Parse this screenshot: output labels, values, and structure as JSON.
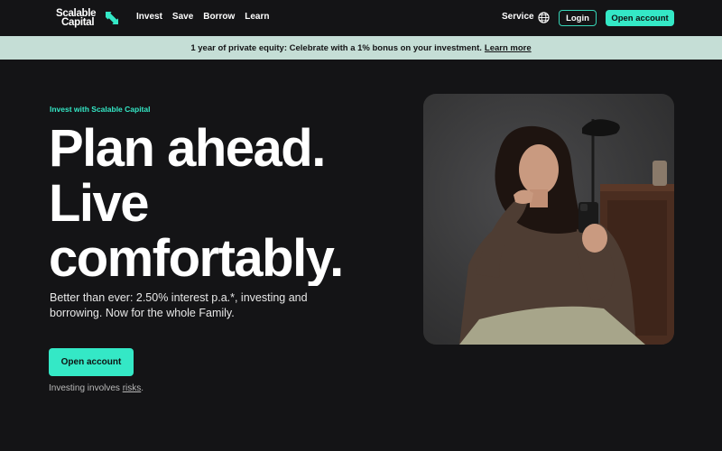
{
  "nav": {
    "logo_line1": "Scalable",
    "logo_line2": "Capital",
    "links": [
      "Invest",
      "Save",
      "Borrow",
      "Learn"
    ],
    "service": "Service",
    "login": "Login",
    "open_account": "Open account"
  },
  "banner": {
    "text": "1 year of private equity: Celebrate with a 1% bonus on your investment.",
    "link": "Learn more"
  },
  "hero": {
    "eyebrow": "Invest with Scalable Capital",
    "headline": [
      "Plan ahead.",
      "Live",
      "comfortably."
    ],
    "subtext": "Better than ever: 2.50% interest p.a.*, investing and borrowing. Now for the whole Family.",
    "cta": "Open account",
    "risk_prefix": "Investing involves ",
    "risk_link": "risks",
    "risk_suffix": "."
  },
  "colors": {
    "background": "#141416",
    "accent": "#34e8c6",
    "banner": "#c5ded6"
  },
  "icons": {
    "globe": "globe-icon",
    "logo": "scalable-logo-icon"
  }
}
